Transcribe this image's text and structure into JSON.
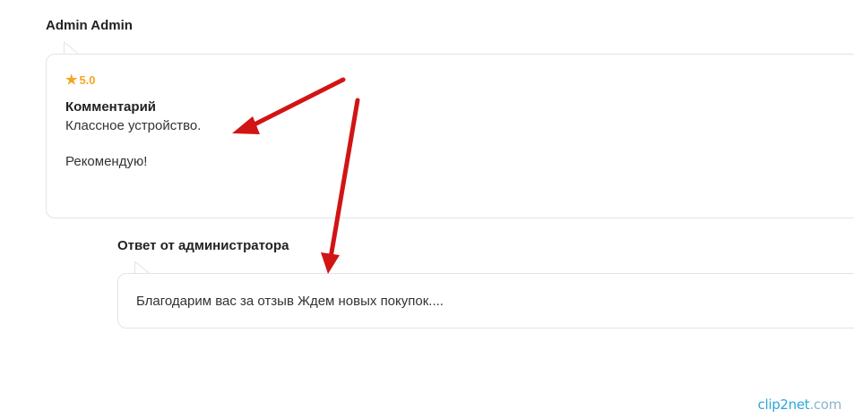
{
  "review": {
    "author": "Admin Admin",
    "rating": "5.0",
    "title": "Комментарий",
    "text_line1": "Классное устройство.",
    "text_line2": "Рекомендую!"
  },
  "reply": {
    "author": "Ответ от администратора",
    "text": "Благодарим вас за отзыв Ждем новых покупок...."
  },
  "watermark": {
    "text": "clip2net",
    "suffix": ".com"
  },
  "colors": {
    "star": "#f5a623",
    "arrow": "#d11414",
    "card_border": "#e4e4e4",
    "watermark": "#2aa8d8"
  },
  "icons": {
    "rating": "star-icon"
  }
}
